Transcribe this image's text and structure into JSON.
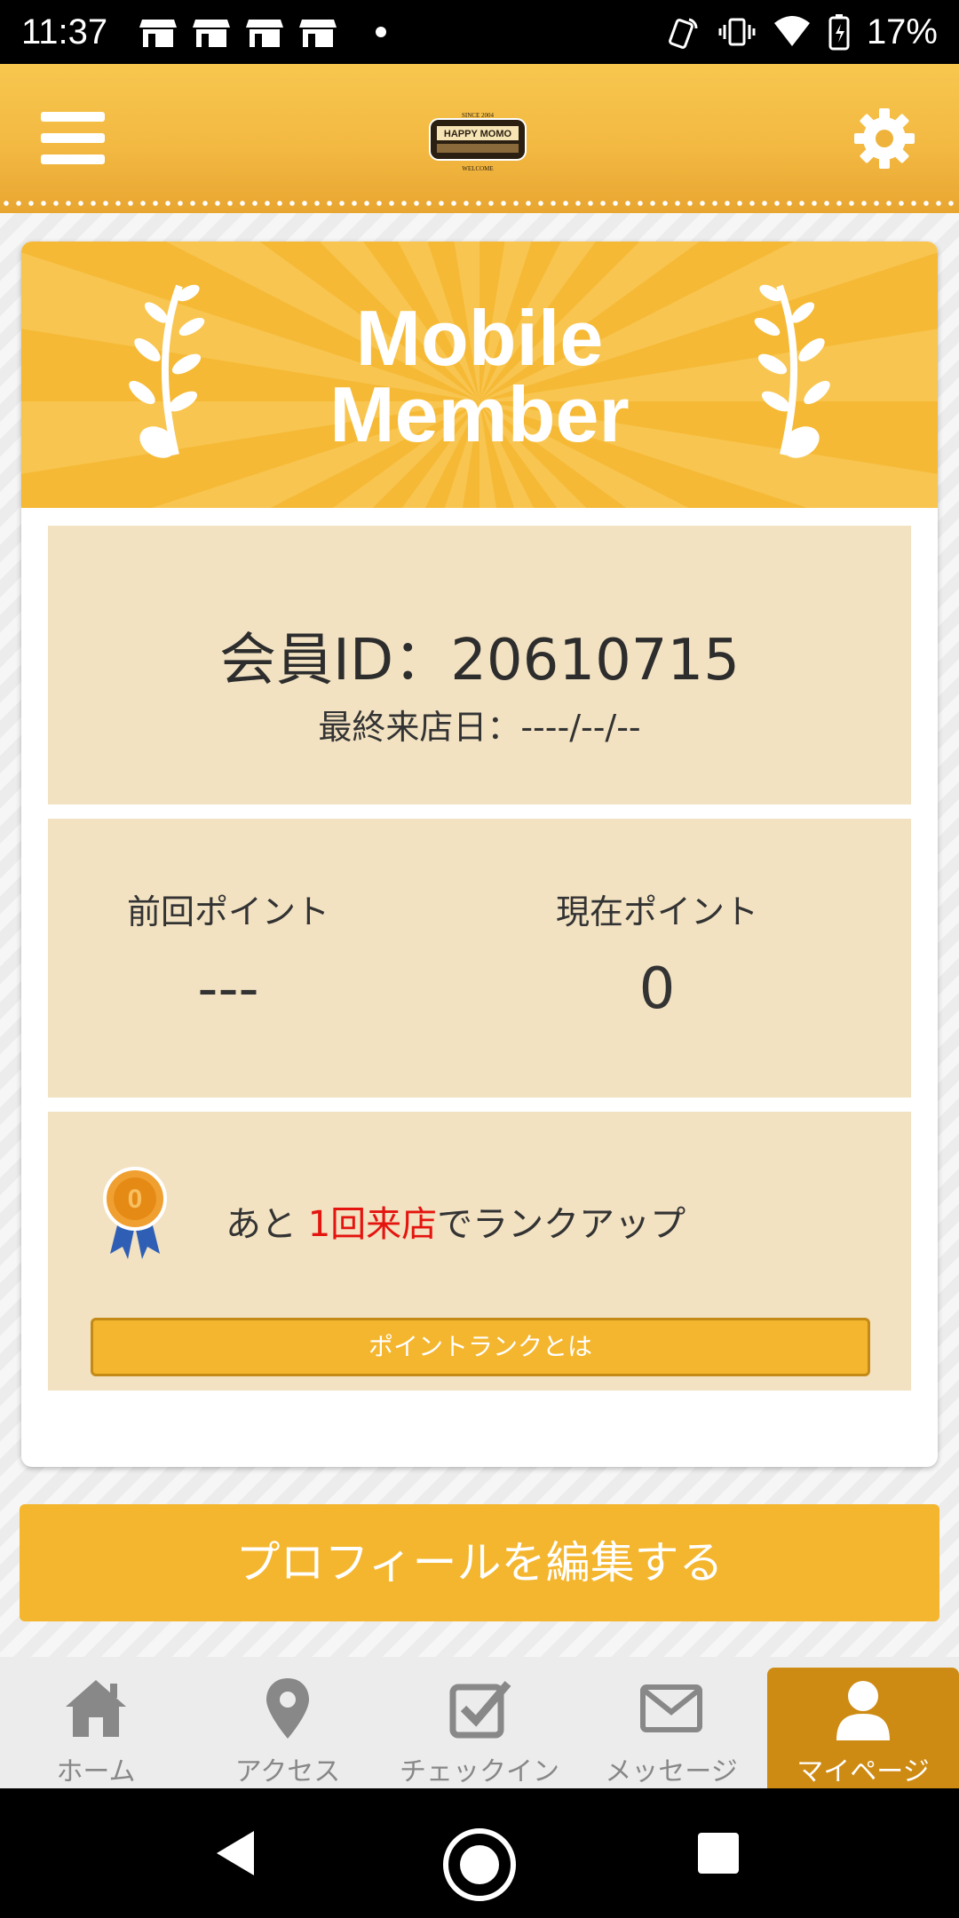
{
  "status_bar": {
    "time": "11:37",
    "battery": "17%",
    "notification_icons": [
      "store-icon",
      "store-icon",
      "store-icon",
      "store-icon"
    ]
  },
  "header": {
    "logo_text": "HAPPY MOMO",
    "logo_since": "SINCE 2004",
    "logo_welcome": "WELCOME"
  },
  "card": {
    "title_line1": "Mobile",
    "title_line2": "Member",
    "member_id": "会員ID：20610715",
    "last_visit": "最終来店日：----/--/--",
    "previous_points_label": "前回ポイント",
    "previous_points_value": "---",
    "current_points_label": "現在ポイント",
    "current_points_value": "0",
    "rank_prefix": "あと ",
    "rank_highlight": "1回来店",
    "rank_suffix": "でランクアップ",
    "rank_button": "ポイントランクとは"
  },
  "profile_button": "プロフィールを編集する",
  "bottom_nav": {
    "items": [
      {
        "label": "ホーム",
        "icon": "home-icon"
      },
      {
        "label": "アクセス",
        "icon": "location-pin-icon"
      },
      {
        "label": "チェックイン",
        "icon": "checkbox-icon"
      },
      {
        "label": "メッセージ",
        "icon": "envelope-icon"
      },
      {
        "label": "マイページ",
        "icon": "user-icon"
      }
    ],
    "active": "マイページ"
  },
  "colors": {
    "accent": "#f4b62e",
    "active_tab": "#ce8b13",
    "panel": "#f2e2c2",
    "highlight": "#e4140f"
  }
}
